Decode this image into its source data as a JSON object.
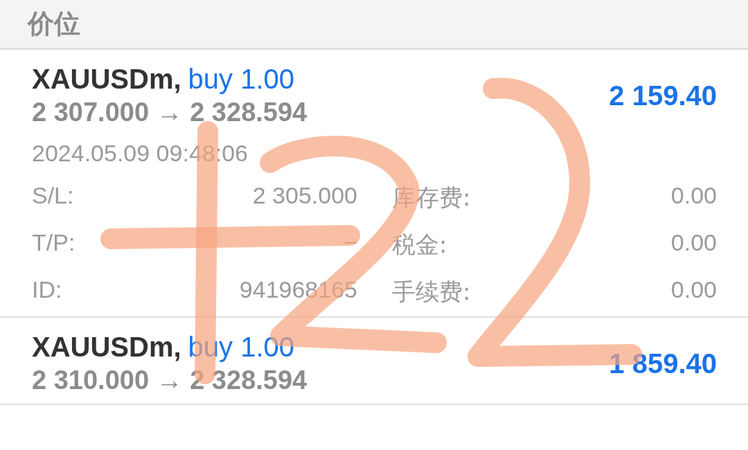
{
  "header": {
    "title": "价位"
  },
  "orders": [
    {
      "symbol": "XAUUSDm,",
      "side": "buy 1.00",
      "prices": "2 307.000 → 2 328.594",
      "profit": "2 159.40",
      "time": "2024.05.09 09:48:06",
      "details": [
        {
          "label": "S/L:",
          "value": "2 305.000",
          "label2": "库存费:",
          "value2": "0.00"
        },
        {
          "label": "T/P:",
          "value": "−",
          "label2": "税金:",
          "value2": "0.00"
        },
        {
          "label": "ID:",
          "value": "941968165",
          "label2": "手续费:",
          "value2": "0.00"
        }
      ]
    },
    {
      "symbol": "XAUUSDm,",
      "side": "buy 1.00",
      "prices": "2 310.000 → 2 328.594",
      "profit": "1 859.40"
    }
  ]
}
